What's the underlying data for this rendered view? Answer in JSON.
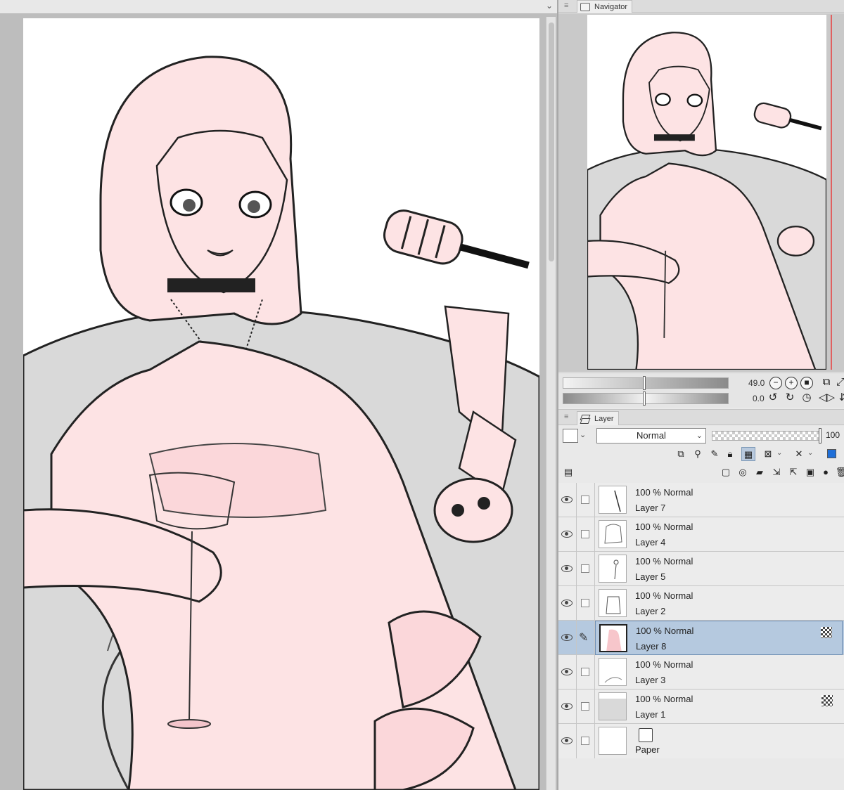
{
  "navigator": {
    "tab_label": "Navigator",
    "zoom_value": "49.0",
    "rotation_value": "0.0"
  },
  "layer_panel": {
    "tab_label": "Layer",
    "blend_mode": "Normal",
    "opacity": "100",
    "layers": [
      {
        "mode": "100 % Normal",
        "name": "Layer 7",
        "selected": false,
        "badge": false
      },
      {
        "mode": "100 % Normal",
        "name": "Layer 4",
        "selected": false,
        "badge": false
      },
      {
        "mode": "100 % Normal",
        "name": "Layer 5",
        "selected": false,
        "badge": false
      },
      {
        "mode": "100 % Normal",
        "name": "Layer 2",
        "selected": false,
        "badge": false
      },
      {
        "mode": "100 % Normal",
        "name": "Layer 8",
        "selected": true,
        "badge": true
      },
      {
        "mode": "100 % Normal",
        "name": "Layer 3",
        "selected": false,
        "badge": false
      },
      {
        "mode": "100 % Normal",
        "name": "Layer 1",
        "selected": false,
        "badge": true
      },
      {
        "mode": "",
        "name": "Paper",
        "selected": false,
        "badge": false
      }
    ]
  },
  "colors": {
    "skin": "#fde3e4",
    "sofa": "#d9d9d9",
    "line": "#1a1a1a",
    "selection": "#b5c9df",
    "accent": "#1f6fd8"
  },
  "icons": [
    "eye-icon",
    "pencil-icon",
    "layers-icon",
    "paper-icon",
    "zoom-out-icon",
    "zoom-in-icon",
    "rotate-icon",
    "flip-icon"
  ]
}
